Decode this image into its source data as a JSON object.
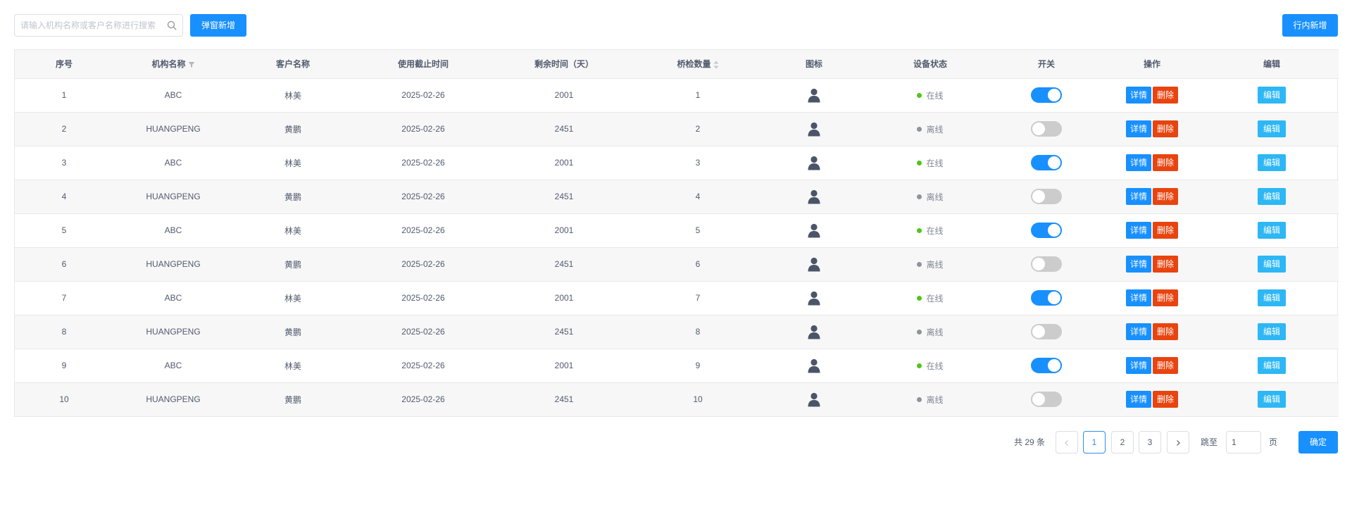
{
  "search": {
    "placeholder": "请输入机构名称或客户名称进行搜索"
  },
  "toolbar": {
    "popup_add_label": "弹窗新增",
    "inline_add_label": "行内新增"
  },
  "table": {
    "columns": [
      "序号",
      "机构名称",
      "客户名称",
      "使用截止时间",
      "剩余时间（天）",
      "桥检数量",
      "图标",
      "设备状态",
      "开关",
      "操作",
      "编辑"
    ],
    "action_labels": {
      "detail": "详情",
      "delete": "删除",
      "edit": "编辑"
    },
    "rows": [
      {
        "index": "1",
        "org": "ABC",
        "customer": "林美",
        "deadline": "2025-02-26",
        "remaining": "2001",
        "count": "1",
        "status": "在线",
        "online": true,
        "switch_on": true
      },
      {
        "index": "2",
        "org": "HUANGPENG",
        "customer": "黄鹏",
        "deadline": "2025-02-26",
        "remaining": "2451",
        "count": "2",
        "status": "离线",
        "online": false,
        "switch_on": false
      },
      {
        "index": "3",
        "org": "ABC",
        "customer": "林美",
        "deadline": "2025-02-26",
        "remaining": "2001",
        "count": "3",
        "status": "在线",
        "online": true,
        "switch_on": true
      },
      {
        "index": "4",
        "org": "HUANGPENG",
        "customer": "黄鹏",
        "deadline": "2025-02-26",
        "remaining": "2451",
        "count": "4",
        "status": "离线",
        "online": false,
        "switch_on": false
      },
      {
        "index": "5",
        "org": "ABC",
        "customer": "林美",
        "deadline": "2025-02-26",
        "remaining": "2001",
        "count": "5",
        "status": "在线",
        "online": true,
        "switch_on": true
      },
      {
        "index": "6",
        "org": "HUANGPENG",
        "customer": "黄鹏",
        "deadline": "2025-02-26",
        "remaining": "2451",
        "count": "6",
        "status": "离线",
        "online": false,
        "switch_on": false
      },
      {
        "index": "7",
        "org": "ABC",
        "customer": "林美",
        "deadline": "2025-02-26",
        "remaining": "2001",
        "count": "7",
        "status": "在线",
        "online": true,
        "switch_on": true
      },
      {
        "index": "8",
        "org": "HUANGPENG",
        "customer": "黄鹏",
        "deadline": "2025-02-26",
        "remaining": "2451",
        "count": "8",
        "status": "离线",
        "online": false,
        "switch_on": false
      },
      {
        "index": "9",
        "org": "ABC",
        "customer": "林美",
        "deadline": "2025-02-26",
        "remaining": "2001",
        "count": "9",
        "status": "在线",
        "online": true,
        "switch_on": true
      },
      {
        "index": "10",
        "org": "HUANGPENG",
        "customer": "黄鹏",
        "deadline": "2025-02-26",
        "remaining": "2451",
        "count": "10",
        "status": "离线",
        "online": false,
        "switch_on": false
      }
    ]
  },
  "pagination": {
    "total_text": "共 29 条",
    "pages": [
      "1",
      "2",
      "3"
    ],
    "current": "1",
    "prev_icon": "chevron-left-icon",
    "next_icon": "chevron-right-icon",
    "jump_label": "跳至",
    "jump_value": "1",
    "page_unit": "页",
    "confirm_label": "确定"
  },
  "colors": {
    "primary": "#1890ff",
    "danger": "#e8440f",
    "edit": "#2db7f5",
    "online": "#52c41a",
    "offline": "#909399"
  }
}
